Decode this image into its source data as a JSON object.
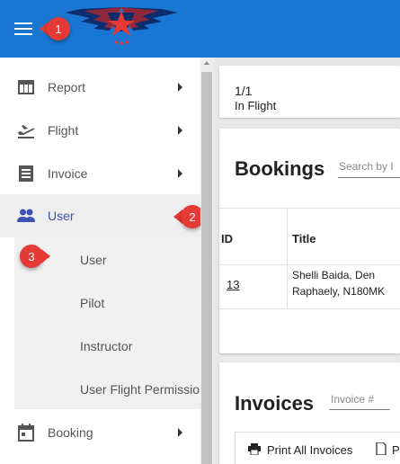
{
  "header": {
    "menu_icon": "hamburger-menu-icon",
    "logo": "winged-star-logo",
    "color": "#1976d2"
  },
  "callouts": [
    "1",
    "2",
    "3"
  ],
  "sidebar": {
    "items": [
      {
        "label": "Report",
        "icon": "table-icon"
      },
      {
        "label": "Flight",
        "icon": "airplane-takeoff-icon"
      },
      {
        "label": "Invoice",
        "icon": "receipt-icon"
      },
      {
        "label": "User",
        "icon": "people-icon"
      },
      {
        "label": "Booking",
        "icon": "calendar-icon"
      }
    ],
    "user_submenu": [
      "User",
      "Pilot",
      "Instructor",
      "User Flight Permission"
    ],
    "active_color": "#3f51b5"
  },
  "main": {
    "flight_status": {
      "count": "1/1",
      "label": "In Flight"
    },
    "bookings": {
      "title": "Bookings",
      "search_placeholder": "Search by I",
      "columns": [
        "ID",
        "Title"
      ],
      "rows": [
        {
          "id": "13",
          "title": "Shelli Baida, Den Raphaely, N180MK"
        }
      ]
    },
    "invoices": {
      "title": "Invoices",
      "search_placeholder": "Invoice #",
      "print_all": "Print All Invoices",
      "second_button": "P"
    }
  }
}
